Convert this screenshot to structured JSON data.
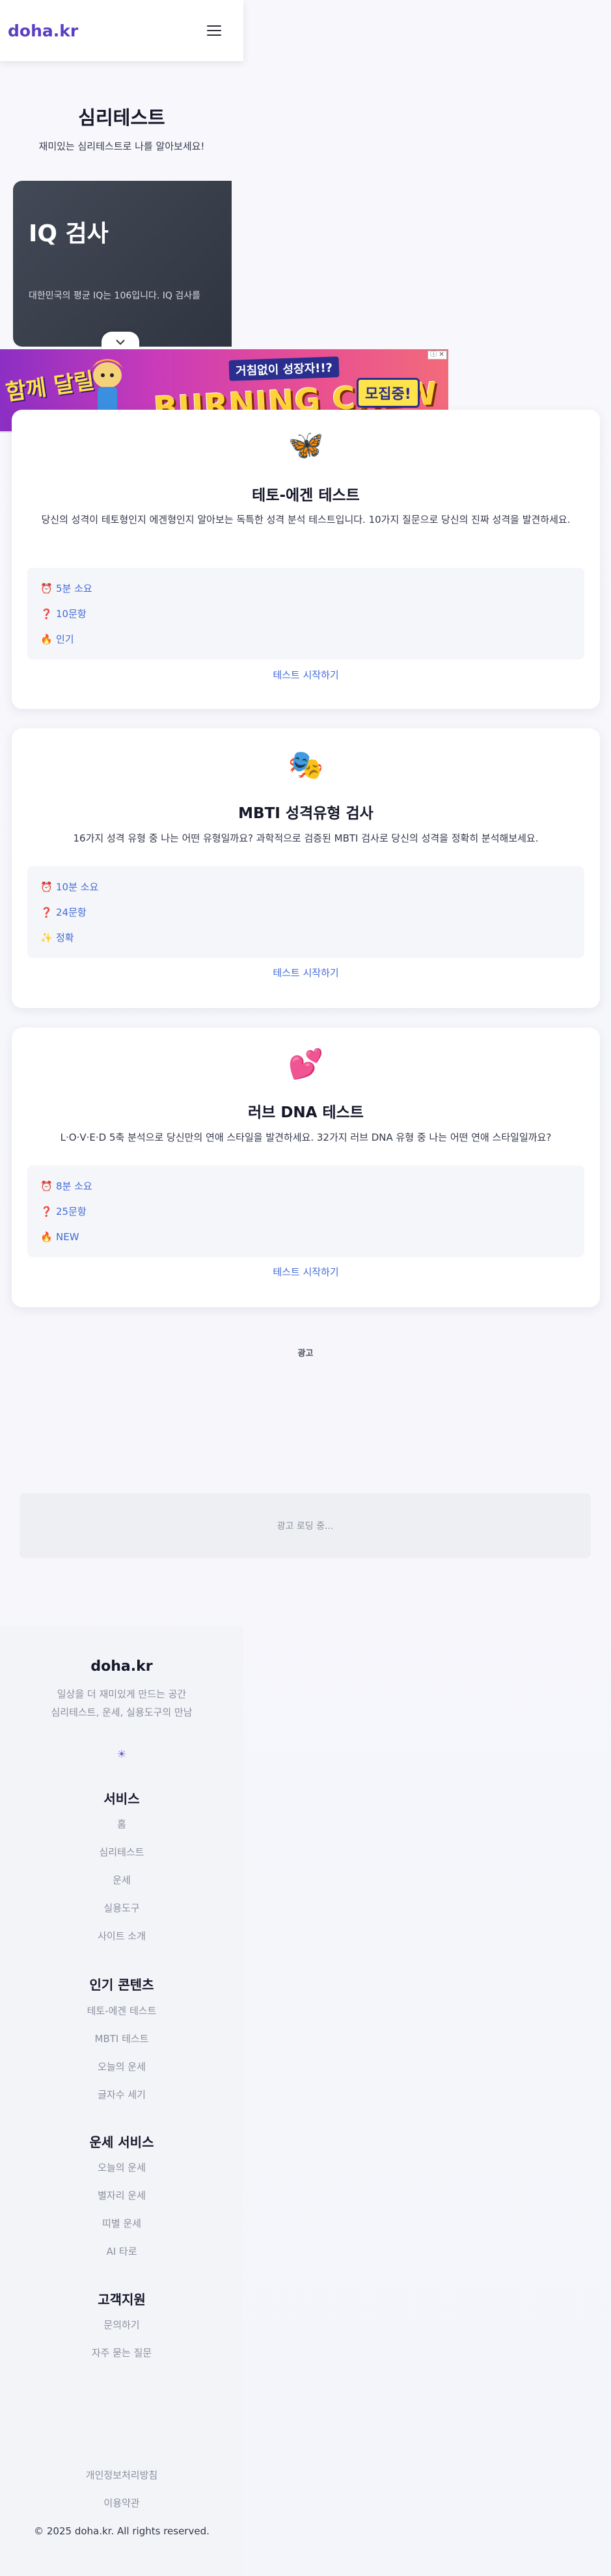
{
  "header": {
    "logo": "doha.kr",
    "menu_icon": "hamburger-menu-icon"
  },
  "hero": {
    "title": "심리테스트",
    "subtitle": "재미있는 심리테스트로 나를 알아보세요!"
  },
  "carousel": {
    "title": "IQ 검사",
    "description": "대한민국의 평균 IQ는 106입니다. IQ 검사를",
    "toggle_icon": "chevron-down-icon"
  },
  "ad_banner": {
    "left_text": "함께 달릴",
    "slogan": "거침없이 성장자!!?",
    "brand": "BURNING CREW",
    "cta": "모집중!",
    "badge": "ⓘ ✕"
  },
  "tests": [
    {
      "icon": "🦋",
      "icon_name": "butterfly-icon",
      "title": "테토-에겐 테스트",
      "description": "당신의 성격이 테토형인지 에겐형인지 알아보는 독특한 성격 분석 테스트입니다. 10가지 질문으로 당신의 진짜 성격을 발견하세요.",
      "meta": [
        {
          "icon": "⏰",
          "icon_name": "alarm-clock-icon",
          "text": "5분 소요"
        },
        {
          "icon": "❓",
          "icon_name": "question-mark-icon",
          "text": "10문항"
        },
        {
          "icon": "🔥",
          "icon_name": "fire-icon",
          "text": "인기"
        }
      ],
      "link": "테스트 시작하기"
    },
    {
      "icon": "🎭",
      "icon_name": "theater-masks-icon",
      "title": "MBTI 성격유형 검사",
      "description": "16가지 성격 유형 중 나는 어떤 유형일까요? 과학적으로 검증된 MBTI 검사로 당신의 성격을 정확히 분석해보세요.",
      "meta": [
        {
          "icon": "⏰",
          "icon_name": "alarm-clock-icon",
          "text": "10분 소요"
        },
        {
          "icon": "❓",
          "icon_name": "question-mark-icon",
          "text": "24문항"
        },
        {
          "icon": "✨",
          "icon_name": "sparkles-icon",
          "text": "정확"
        }
      ],
      "link": "테스트 시작하기"
    },
    {
      "icon": "💕",
      "icon_name": "two-hearts-icon",
      "title": "러브 DNA 테스트",
      "description": "L·O·V·E·D 5축 분석으로 당신만의 연애 스타일을 발견하세요. 32가지 러브 DNA 유형 중 나는 어떤 연애 스타일일까요?",
      "meta": [
        {
          "icon": "⏰",
          "icon_name": "alarm-clock-icon",
          "text": "8분 소요"
        },
        {
          "icon": "❓",
          "icon_name": "question-mark-icon",
          "text": "25문항"
        },
        {
          "icon": "🔥",
          "icon_name": "fire-icon",
          "text": "NEW"
        }
      ],
      "link": "테스트 시작하기"
    }
  ],
  "ad": {
    "label": "광고",
    "loading": "광고 로딩 중..."
  },
  "footer": {
    "brand": "doha.kr",
    "tagline_1": "일상을 더 재미있게 만드는 공간",
    "tagline_2": "심리테스트, 운세, 실용도구의 만남",
    "sun_icon": "☀",
    "sections": [
      {
        "heading": "서비스",
        "links": [
          "홈",
          "심리테스트",
          "운세",
          "실용도구",
          "사이트 소개"
        ]
      },
      {
        "heading": "인기 콘텐츠",
        "links": [
          "테토-에겐 테스트",
          "MBTI 테스트",
          "오늘의 운세",
          "글자수 세기"
        ]
      },
      {
        "heading": "운세 서비스",
        "links": [
          "오늘의 운세",
          "별자리 운세",
          "띠별 운세",
          "AI 타로"
        ]
      },
      {
        "heading": "고객지원",
        "links": [
          "문의하기",
          "자주 묻는 질문"
        ]
      }
    ],
    "legal": [
      "개인정보처리방침",
      "이용약관"
    ],
    "copyright": "© 2025 doha.kr. All rights reserved."
  }
}
